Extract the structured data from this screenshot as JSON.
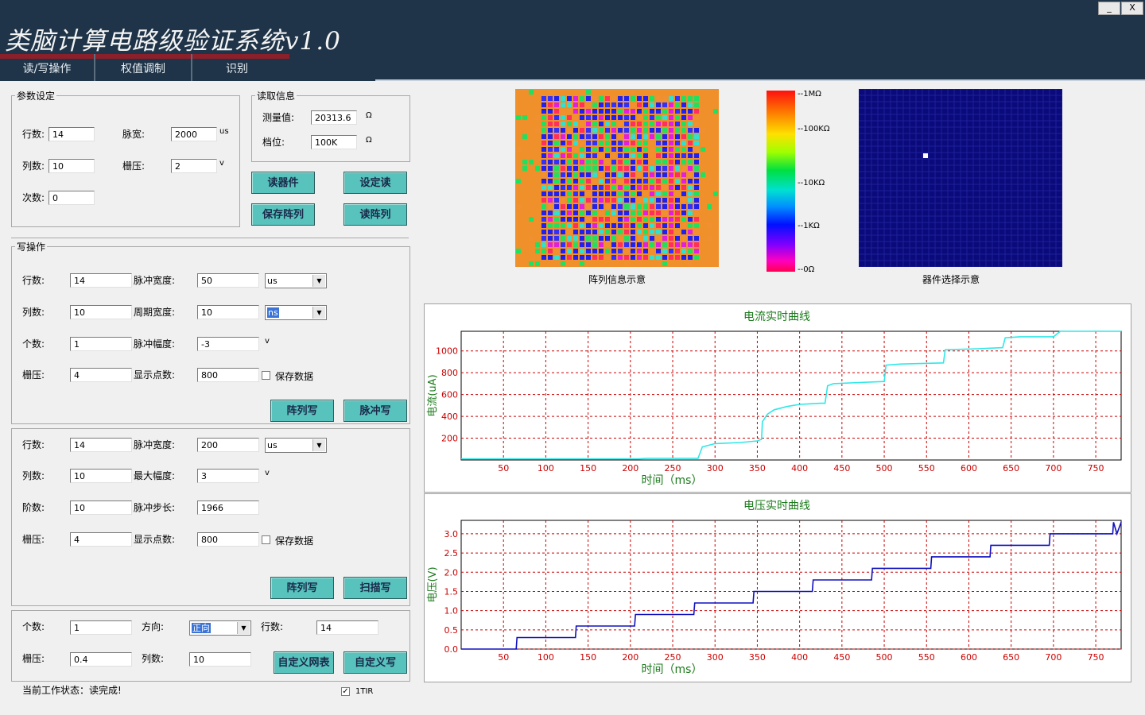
{
  "app": {
    "title": "类脑计算电路级验证系统v1.0",
    "window_controls": {
      "minimize": "_",
      "close": "X"
    }
  },
  "menu": [
    {
      "label": "读/写操作"
    },
    {
      "label": "权值调制"
    },
    {
      "label": "识别"
    }
  ],
  "params": {
    "legend": "参数设定",
    "rows_label": "行数:",
    "rows": "14",
    "cols_label": "列数:",
    "cols": "10",
    "count_label": "次数:",
    "count": "0",
    "pulse_width_label": "脉宽:",
    "pulse_width": "2000",
    "pulse_width_unit": "us",
    "gate_label": "栅压:",
    "gate": "2",
    "gate_unit": "v"
  },
  "read_info": {
    "legend": "读取信息",
    "measured_label": "测量值:",
    "measured": "20313.6",
    "measured_unit": "Ω",
    "range_label": "档位:",
    "range": "100K",
    "range_unit": "Ω",
    "read_device_button": "读器件",
    "set_read_button": "设定读",
    "save_array_button": "保存阵列",
    "read_array_button": "读阵列"
  },
  "write_op": {
    "legend": "写操作",
    "rows_label": "行数:",
    "rows": "14",
    "cols_label": "列数:",
    "cols": "10",
    "count_label": "个数:",
    "count": "1",
    "gate_label": "栅压:",
    "gate": "4",
    "pulse_width_label": "脉冲宽度:",
    "pulse_width": "50",
    "pulse_width_unit": "us",
    "period_label": "周期宽度:",
    "period": "10",
    "period_unit": "ns",
    "amplitude_label": "脉冲幅度:",
    "amplitude": "-3",
    "amplitude_unit": "v",
    "points_label": "显示点数:",
    "points": "800",
    "save_data_label": "保存数据",
    "array_write_button": "阵列写",
    "pulse_write_button": "脉冲写"
  },
  "sweep_op": {
    "rows_label": "行数:",
    "rows": "14",
    "cols_label": "列数:",
    "cols": "10",
    "steps_label": "阶数:",
    "steps": "10",
    "gate_label": "栅压:",
    "gate": "4",
    "pulse_width_label": "脉冲宽度:",
    "pulse_width": "200",
    "pulse_width_unit": "us",
    "max_amp_label": "最大幅度:",
    "max_amp": "3",
    "max_amp_unit": "v",
    "pulse_step_label": "脉冲步长:",
    "pulse_step": "1966",
    "points_label": "显示点数:",
    "points": "800",
    "save_data_label": "保存数据",
    "array_write_button": "阵列写",
    "sweep_write_button": "扫描写"
  },
  "custom_op": {
    "count_label": "个数:",
    "count": "1",
    "gate_label": "栅压:",
    "gate": "0.4",
    "direction_label": "方向:",
    "direction": "正向",
    "rows_label": "行数:",
    "rows": "14",
    "cols_label": "列数:",
    "cols": "10",
    "custom_netlist_button": "自定义网表",
    "custom_write_button": "自定义写"
  },
  "status": {
    "text": "当前工作状态：读完成!",
    "checkbox_label": "1TIR",
    "checkbox_checked": true
  },
  "array_map": {
    "caption": "阵列信息示意",
    "colorbar_labels": [
      "--1MΩ",
      "--100KΩ",
      "--10KΩ",
      "--1KΩ",
      "--0Ω"
    ],
    "device_caption": "器件选择示意",
    "border_color": "#f0902a",
    "selected_cell_color": "#ffffff",
    "device_bg": "#0a0a7a"
  },
  "colors": {
    "titlebar": "#1f3448",
    "button_bg": "#58c2bd",
    "current_line": "#2ee8e8",
    "voltage_line": "#1010c0",
    "grid_red": "#cc0000",
    "axis_title": "#1a7a1a"
  },
  "chart_data": [
    {
      "type": "line",
      "title": "电流实时曲线",
      "xlabel": "时间（ms）",
      "ylabel": "电流(uA)",
      "xlim": [
        0,
        780
      ],
      "ylim": [
        0,
        1180
      ],
      "xticks": [
        50,
        100,
        150,
        200,
        250,
        300,
        350,
        400,
        450,
        500,
        550,
        600,
        650,
        700,
        750
      ],
      "yticks": [
        200,
        400,
        600,
        800,
        1000
      ],
      "grid": true,
      "series": [
        {
          "values": [
            [
              0,
              10
            ],
            [
              210,
              10
            ],
            [
              220,
              15
            ],
            [
              280,
              15
            ],
            [
              285,
              120
            ],
            [
              290,
              130
            ],
            [
              300,
              150
            ],
            [
              330,
              160
            ],
            [
              350,
              175
            ],
            [
              355,
              190
            ],
            [
              356,
              350
            ],
            [
              362,
              420
            ],
            [
              370,
              460
            ],
            [
              385,
              490
            ],
            [
              400,
              510
            ],
            [
              425,
              520
            ],
            [
              430,
              520
            ],
            [
              433,
              680
            ],
            [
              440,
              700
            ],
            [
              470,
              710
            ],
            [
              500,
              720
            ],
            [
              502,
              870
            ],
            [
              520,
              880
            ],
            [
              570,
              890
            ],
            [
              572,
              1010
            ],
            [
              610,
              1020
            ],
            [
              640,
              1030
            ],
            [
              643,
              1120
            ],
            [
              660,
              1130
            ],
            [
              700,
              1130
            ],
            [
              708,
              1180
            ],
            [
              780,
              1180
            ]
          ]
        }
      ]
    },
    {
      "type": "line",
      "title": "电压实时曲线",
      "xlabel": "时间（ms）",
      "ylabel": "电压(V)",
      "xlim": [
        0,
        780
      ],
      "ylim": [
        0,
        3.35
      ],
      "xticks": [
        50,
        100,
        150,
        200,
        250,
        300,
        350,
        400,
        450,
        500,
        550,
        600,
        650,
        700,
        750
      ],
      "yticks": [
        0.0,
        0.5,
        1.0,
        1.5,
        2.0,
        2.5,
        3.0
      ],
      "grid": true,
      "series": [
        {
          "values": [
            [
              0,
              0
            ],
            [
              65,
              0
            ],
            [
              66,
              0.3
            ],
            [
              135,
              0.3
            ],
            [
              136,
              0.6
            ],
            [
              205,
              0.6
            ],
            [
              206,
              0.9
            ],
            [
              275,
              0.9
            ],
            [
              276,
              1.2
            ],
            [
              345,
              1.2
            ],
            [
              346,
              1.5
            ],
            [
              415,
              1.5
            ],
            [
              416,
              1.8
            ],
            [
              485,
              1.8
            ],
            [
              486,
              2.1
            ],
            [
              555,
              2.1
            ],
            [
              556,
              2.4
            ],
            [
              625,
              2.4
            ],
            [
              626,
              2.7
            ],
            [
              695,
              2.7
            ],
            [
              696,
              3.0
            ],
            [
              770,
              3.0
            ],
            [
              771,
              3.3
            ],
            [
              775,
              3.0
            ],
            [
              780,
              3.3
            ]
          ]
        }
      ]
    }
  ]
}
